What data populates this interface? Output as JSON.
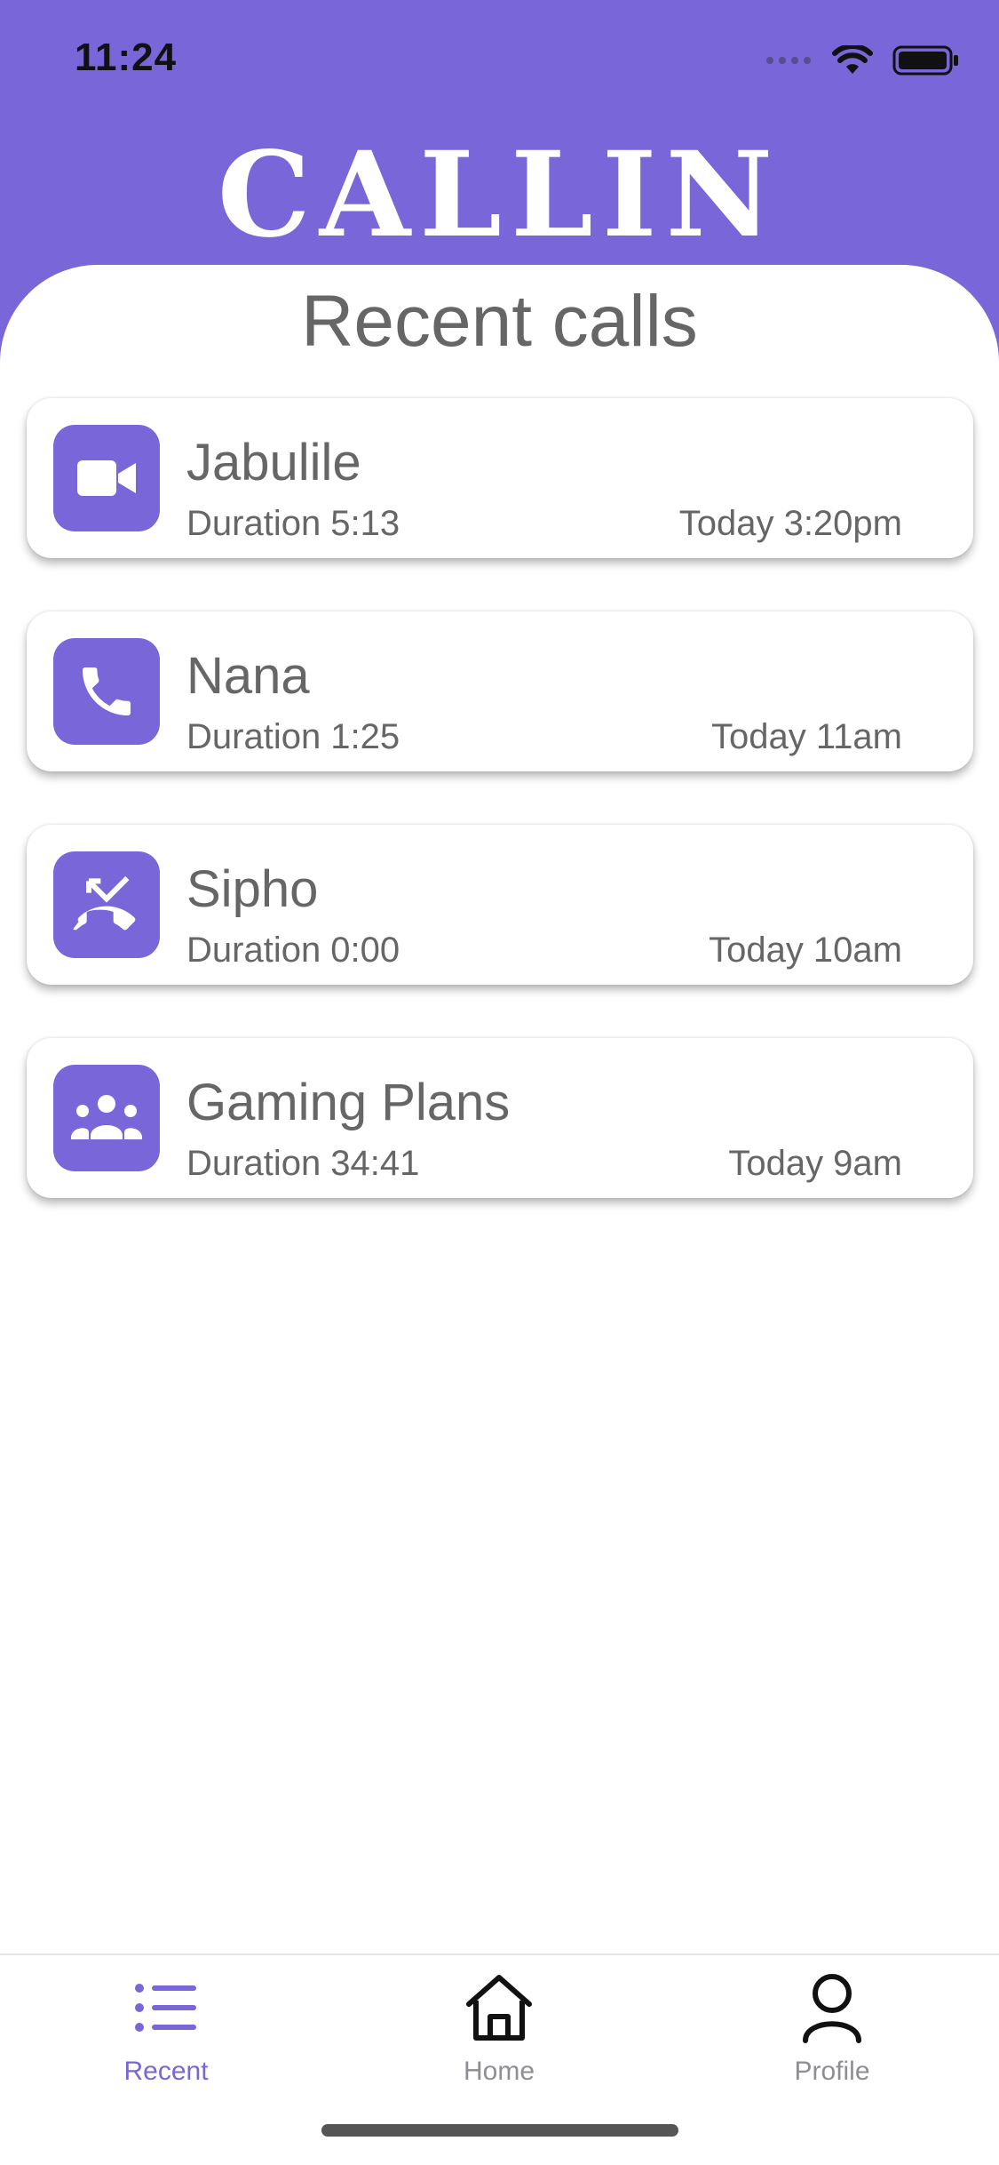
{
  "status_bar": {
    "time": "11:24"
  },
  "app": {
    "logo_text": "CALLIN",
    "brand_color": "#7966D9"
  },
  "page": {
    "title": "Recent calls"
  },
  "calls": [
    {
      "name": "Jabulile",
      "duration": "Duration 5:13",
      "time": "Today 3:20pm",
      "icon": "video-call-icon"
    },
    {
      "name": "Nana",
      "duration": "Duration 1:25",
      "time": "Today 11am",
      "icon": "phone-icon"
    },
    {
      "name": "Sipho",
      "duration": "Duration 0:00",
      "time": "Today 10am",
      "icon": "missed-call-icon"
    },
    {
      "name": "Gaming Plans",
      "duration": "Duration 34:41",
      "time": "Today 9am",
      "icon": "group-icon"
    }
  ],
  "tabs": [
    {
      "label": "Recent",
      "icon": "list-icon",
      "active": true,
      "color": "#7966D9"
    },
    {
      "label": "Home",
      "icon": "home-icon",
      "active": false,
      "color": "#8e8e93"
    },
    {
      "label": "Profile",
      "icon": "profile-icon",
      "active": false,
      "color": "#8e8e93"
    }
  ]
}
